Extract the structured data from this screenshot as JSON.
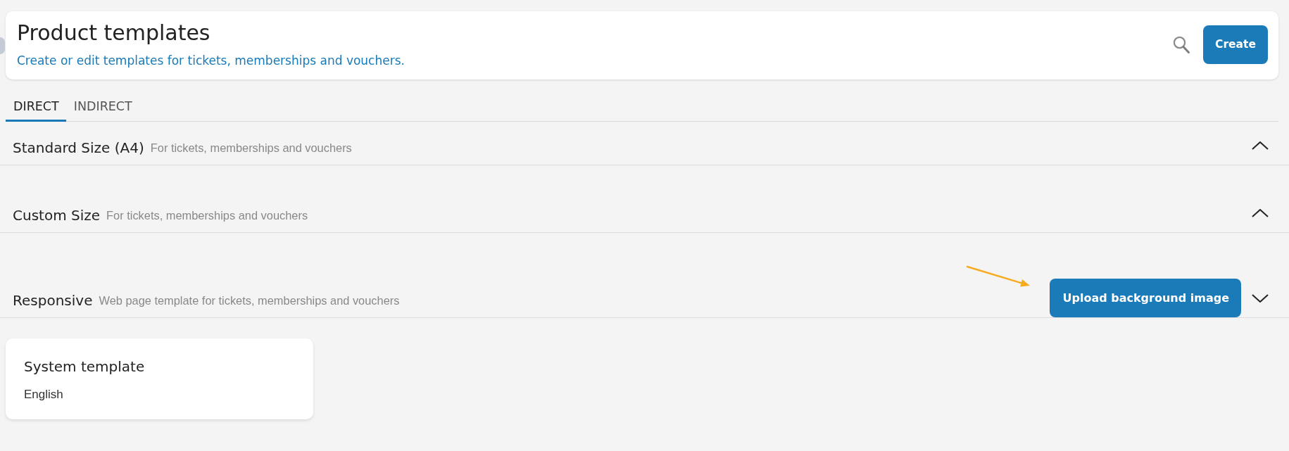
{
  "header": {
    "title": "Product templates",
    "subtitle": "Create or edit templates for tickets, memberships and vouchers.",
    "create_button": "Create"
  },
  "tabs": [
    {
      "label": "DIRECT",
      "selected": true
    },
    {
      "label": "INDIRECT",
      "selected": false
    }
  ],
  "sections": [
    {
      "title": "Standard Size (A4)",
      "description": "For tickets, memberships and vouchers",
      "expanded": false
    },
    {
      "title": "Custom Size",
      "description": "For tickets, memberships and vouchers",
      "expanded": false
    },
    {
      "title": "Responsive",
      "description": "Web page template for tickets, memberships and vouchers",
      "expanded": true,
      "action_button": "Upload background image",
      "templates": [
        {
          "title": "System template",
          "language": "English"
        }
      ]
    }
  ]
}
